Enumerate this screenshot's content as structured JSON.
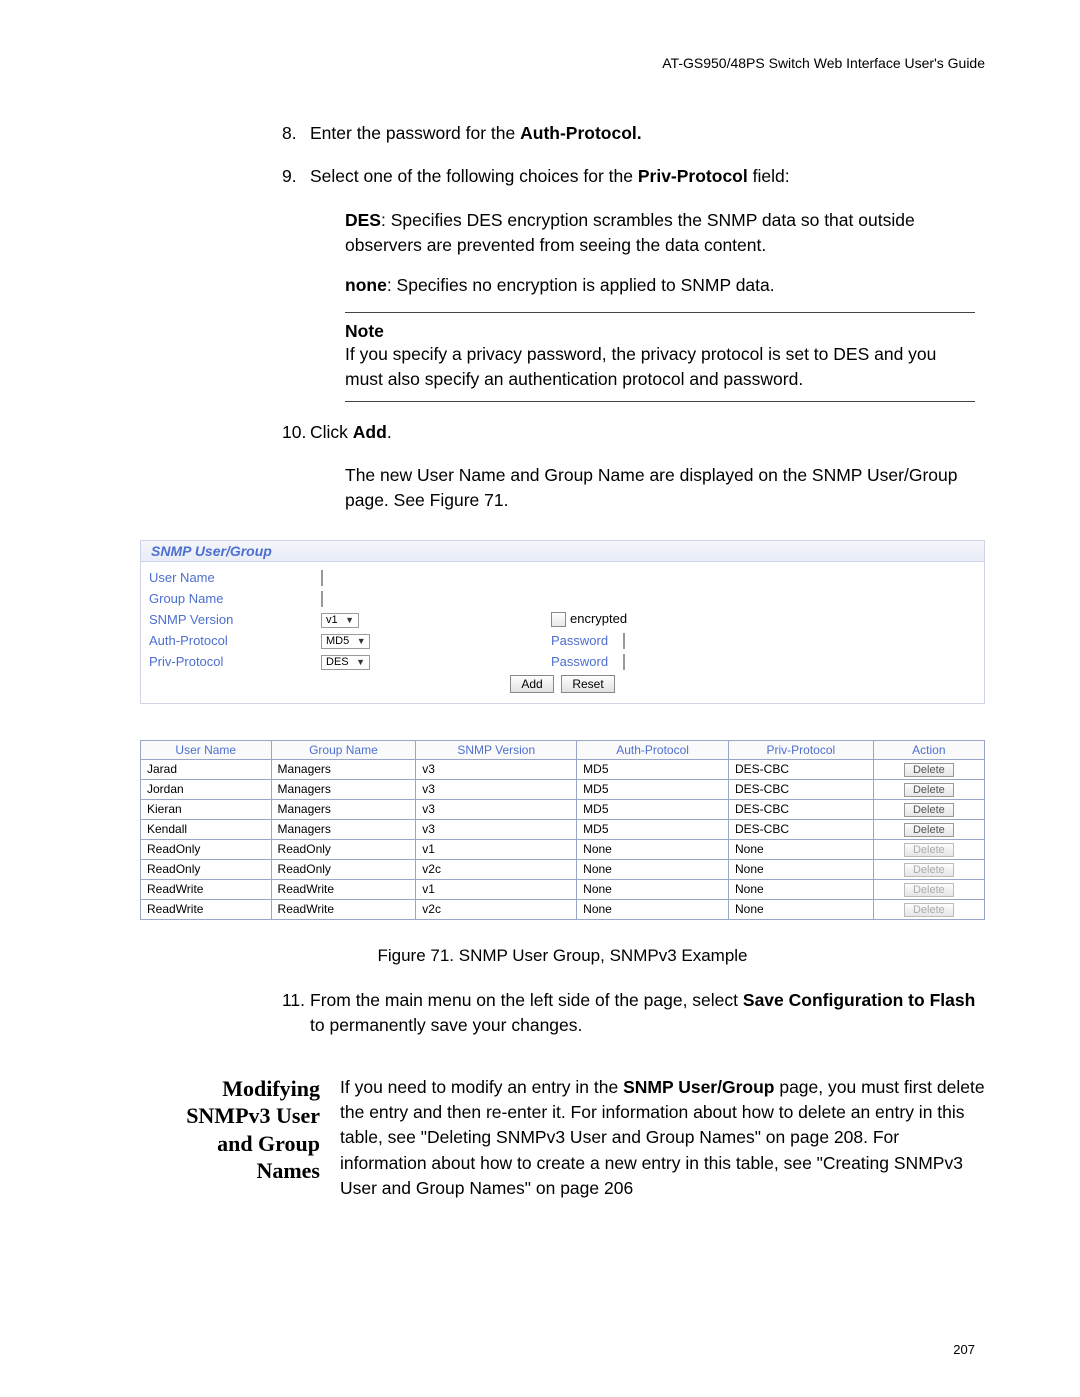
{
  "header": "AT-GS950/48PS Switch Web Interface User's Guide",
  "step8_pre": "Enter the password for the ",
  "step8_bold": "Auth-Protocol.",
  "step9_pre": "Select one of the following choices for the ",
  "step9_bold": "Priv-Protocol",
  "step9_post": " field:",
  "des_label": "DES",
  "des_text": ": Specifies DES encryption scrambles the SNMP data so that outside observers are prevented from seeing the data content.",
  "none_label": "none",
  "none_text": ": Specifies no encryption is applied to SNMP data.",
  "note_label": "Note",
  "note_text": "If you specify a privacy password, the privacy protocol is set to DES and you must also specify an authentication protocol and password.",
  "step10_pre": "Click ",
  "step10_bold": "Add",
  "step10_post": ".",
  "step10_result": "The new User Name and Group Name are displayed on the SNMP User/Group page. See Figure 71.",
  "panel": {
    "title": "SNMP User/Group",
    "labels": {
      "user_name": "User Name",
      "group_name": "Group Name",
      "snmp_version": "SNMP Version",
      "auth_protocol": "Auth-Protocol",
      "priv_protocol": "Priv-Protocol",
      "encrypted": "encrypted",
      "password": "Password"
    },
    "selects": {
      "snmp_version": "v1",
      "auth_protocol": "MD5",
      "priv_protocol": "DES"
    },
    "buttons": {
      "add": "Add",
      "reset": "Reset"
    }
  },
  "columns": [
    "User Name",
    "Group Name",
    "SNMP Version",
    "Auth-Protocol",
    "Priv-Protocol",
    "Action"
  ],
  "rows": [
    {
      "u": "Jarad",
      "g": "Managers",
      "v": "v3",
      "a": "MD5",
      "p": "DES-CBC",
      "en": true
    },
    {
      "u": "Jordan",
      "g": "Managers",
      "v": "v3",
      "a": "MD5",
      "p": "DES-CBC",
      "en": true
    },
    {
      "u": "Kieran",
      "g": "Managers",
      "v": "v3",
      "a": "MD5",
      "p": "DES-CBC",
      "en": true
    },
    {
      "u": "Kendall",
      "g": "Managers",
      "v": "v3",
      "a": "MD5",
      "p": "DES-CBC",
      "en": true
    },
    {
      "u": "ReadOnly",
      "g": "ReadOnly",
      "v": "v1",
      "a": "None",
      "p": "None",
      "en": false
    },
    {
      "u": "ReadOnly",
      "g": "ReadOnly",
      "v": "v2c",
      "a": "None",
      "p": "None",
      "en": false
    },
    {
      "u": "ReadWrite",
      "g": "ReadWrite",
      "v": "v1",
      "a": "None",
      "p": "None",
      "en": false
    },
    {
      "u": "ReadWrite",
      "g": "ReadWrite",
      "v": "v2c",
      "a": "None",
      "p": "None",
      "en": false
    }
  ],
  "delete_label": "Delete",
  "fig_caption": "Figure 71. SNMP User Group, SNMPv3 Example",
  "step11_pre": "From the main menu on the left side of the page, select ",
  "step11_b1": "Save Configuration to Flash",
  "step11_post": " to permanently save your changes.",
  "side_head": "Modifying SNMPv3 User and Group Names",
  "side_body_pre": "If you need to modify an entry in the ",
  "side_body_bold": "SNMP User/Group",
  "side_body_post": " page, you must first delete the entry and then re-enter it. For information about how to delete an entry in this table, see \"Deleting SNMPv3 User and Group Names\" on page 208. For information about how to create a new entry in this table, see \"Creating SNMPv3 User and Group Names\" on page 206",
  "page_number": "207"
}
